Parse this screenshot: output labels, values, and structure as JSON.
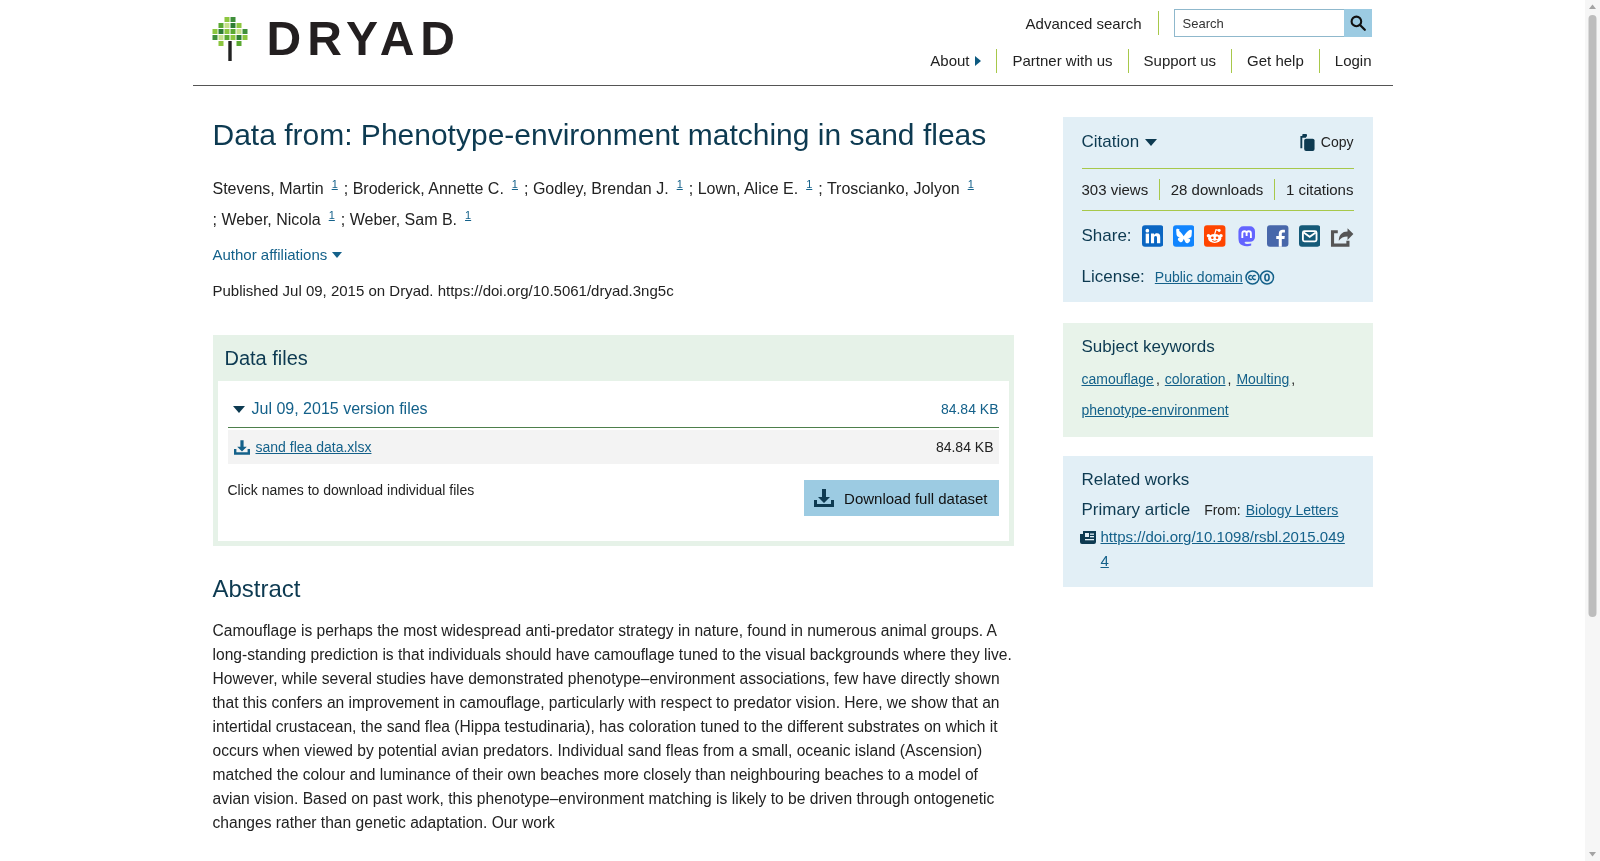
{
  "header": {
    "logo": "DRYAD",
    "advanced_search": "Advanced search",
    "search": {
      "placeholder": "Search"
    },
    "nav": [
      {
        "label": "About",
        "submenu": true
      },
      {
        "label": "Partner with us",
        "submenu": false
      },
      {
        "label": "Support us",
        "submenu": false
      },
      {
        "label": "Get help",
        "submenu": false
      },
      {
        "label": "Login",
        "submenu": false
      }
    ]
  },
  "dataset": {
    "title": "Data from: Phenotype-environment matching in sand fleas",
    "authors": {
      "separator": ";",
      "list": [
        {
          "name": "Stevens, Martin",
          "affiliation": "1"
        },
        {
          "name": "Broderick, Annette C.",
          "affiliation": "1"
        },
        {
          "name": "Godley, Brendan J.",
          "affiliation": "1"
        },
        {
          "name": "Lown, Alice E.",
          "affiliation": "1"
        },
        {
          "name": "Troscianko, Jolyon",
          "affiliation": "1"
        },
        {
          "name": "Weber, Nicola",
          "affiliation": "1"
        },
        {
          "name": "Weber, Sam B.",
          "affiliation": "1"
        }
      ]
    },
    "affiliations_toggle": "Author affiliations",
    "published": "Published Jul 09, 2015 on Dryad. https://doi.org/10.5061/dryad.3ng5c"
  },
  "data_files": {
    "title": "Data files",
    "versions": [
      {
        "label": "Jul 09, 2015 version files",
        "size": "84.84 KB",
        "expanded": true,
        "files": [
          {
            "name": "sand flea data.xlsx",
            "size": "84.84 KB"
          }
        ]
      }
    ],
    "hint": "Click names to download individual files",
    "download_button": "Download full dataset"
  },
  "abstract": {
    "title": "Abstract",
    "text": "Camouflage is perhaps the most widespread anti-predator strategy in nature, found in numerous animal groups. A long-standing prediction is that individuals should have camouflage tuned to the visual backgrounds where they live. However, while several studies have demonstrated phenotype–environment associations, few have directly shown that this confers an improvement in camouflage, particularly with respect to predator vision. Here, we show that an intertidal crustacean, the sand flea (Hippa testudinaria), has coloration tuned to the different substrates on which it occurs when viewed by potential avian predators. Individual sand fleas from a small, oceanic island (Ascension) matched the colour and luminance of their own beaches more closely than neighbouring beaches to a model of avian vision. Based on past work, this phenotype–environment matching is likely to be driven through ontogenetic changes rather than genetic adaptation. Our work"
  },
  "sidebar": {
    "citation": {
      "title": "Citation",
      "copy": "Copy",
      "stats": [
        "303 views",
        "28 downloads",
        "1 citations"
      ],
      "share_label": "Share:",
      "license_label": "License:",
      "license": "Public domain"
    },
    "keywords": {
      "title": "Subject keywords",
      "separator": ",",
      "items": [
        "camouflage",
        "coloration",
        "Moulting",
        "phenotype-environment"
      ]
    },
    "related_works": {
      "title": "Related works",
      "items": [
        {
          "type": "Primary article",
          "from_label": "From:",
          "source": "Biology Letters",
          "doi": "https://doi.org/10.1098/rsbl.2015.0494"
        }
      ]
    }
  }
}
